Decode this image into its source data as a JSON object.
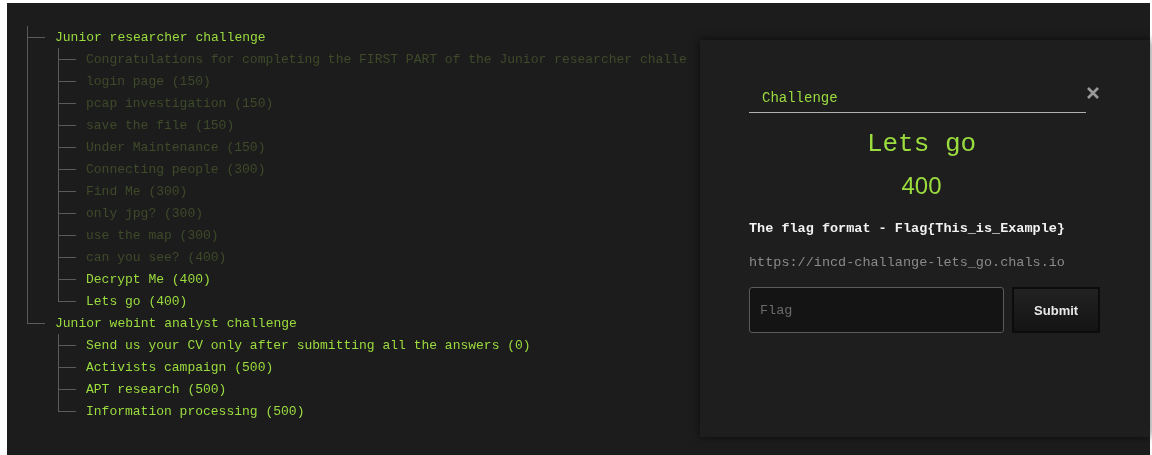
{
  "tree": [
    {
      "label": "Junior researcher challenge",
      "solved": false,
      "children": [
        {
          "label": "Congratulations for completing the FIRST PART of the Junior researcher challe",
          "solved": true
        },
        {
          "label": "login page (150)",
          "solved": true
        },
        {
          "label": "pcap investigation (150)",
          "solved": true
        },
        {
          "label": "save the file (150)",
          "solved": true
        },
        {
          "label": "Under Maintenance (150)",
          "solved": true
        },
        {
          "label": "Connecting people (300)",
          "solved": true
        },
        {
          "label": "Find Me (300)",
          "solved": true
        },
        {
          "label": "only jpg? (300)",
          "solved": true
        },
        {
          "label": "use the map (300)",
          "solved": true
        },
        {
          "label": "can you see? (400)",
          "solved": true
        },
        {
          "label": "Decrypt Me (400)",
          "solved": false
        },
        {
          "label": "Lets go (400)",
          "solved": false
        }
      ]
    },
    {
      "label": "Junior webint analyst challenge",
      "solved": false,
      "children": [
        {
          "label": "Send us your CV only after submitting all the answers (0)",
          "solved": false
        },
        {
          "label": "Activists campaign (500)",
          "solved": false
        },
        {
          "label": "APT research (500)",
          "solved": false
        },
        {
          "label": "Information processing (500)",
          "solved": false
        }
      ]
    }
  ],
  "modal": {
    "tab": "Challenge",
    "title": "Lets go",
    "points": "400",
    "description": "The flag format - Flag{This_is_Example}",
    "url": "https://incd-challange-lets_go.chals.io",
    "input": {
      "placeholder": "Flag"
    },
    "button": "Submit"
  }
}
